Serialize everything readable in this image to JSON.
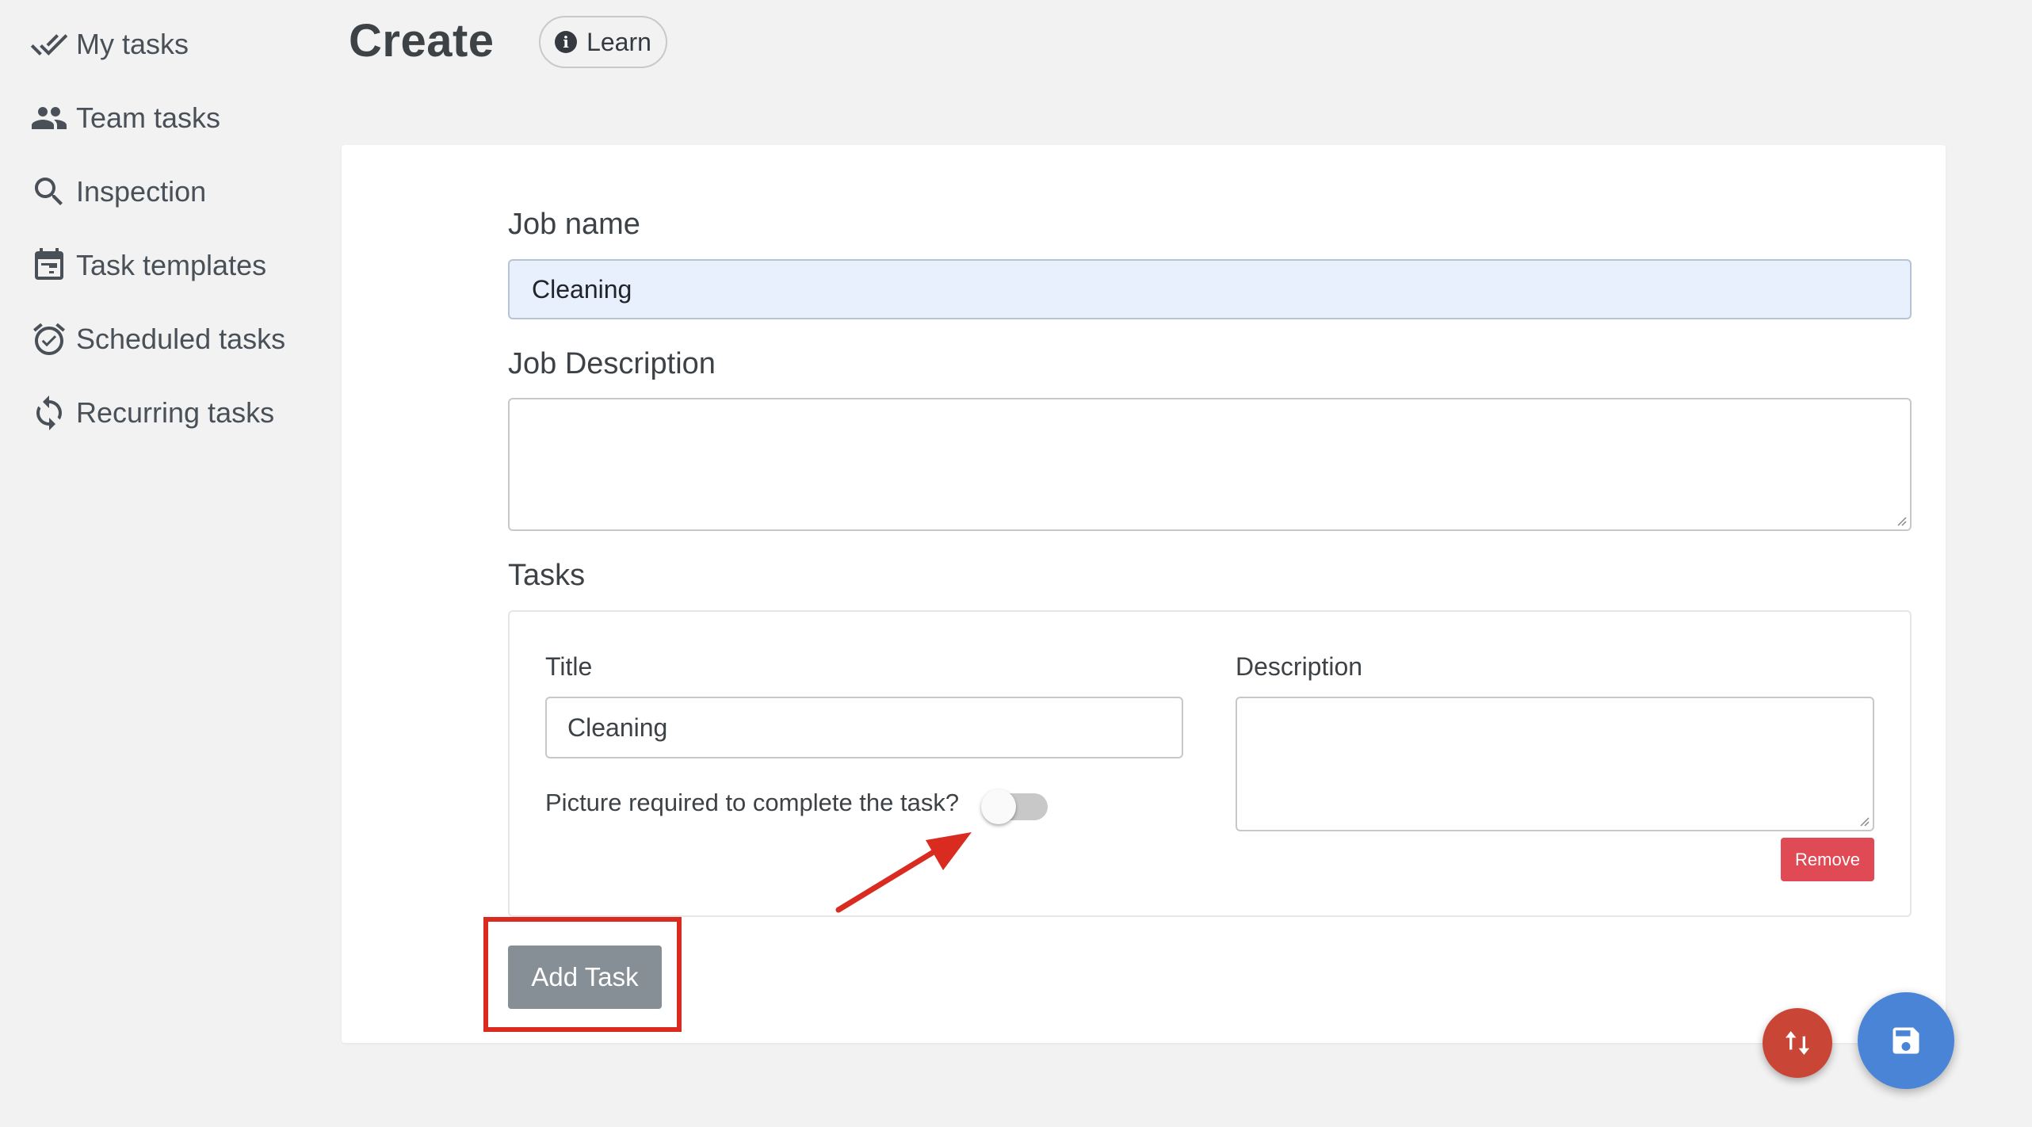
{
  "sidebar": {
    "items": [
      {
        "label": "My tasks",
        "icon": "double-check-icon"
      },
      {
        "label": "Team tasks",
        "icon": "people-icon"
      },
      {
        "label": "Inspection",
        "icon": "search-icon"
      },
      {
        "label": "Task templates",
        "icon": "calendar-icon"
      },
      {
        "label": "Scheduled tasks",
        "icon": "alarm-clock-icon"
      },
      {
        "label": "Recurring tasks",
        "icon": "sync-icon"
      }
    ]
  },
  "header": {
    "title": "Create",
    "learn_label": "Learn"
  },
  "form": {
    "job_name_label": "Job name",
    "job_name_value": "Cleaning",
    "job_description_label": "Job Description",
    "job_description_value": "",
    "tasks_label": "Tasks",
    "task": {
      "title_label": "Title",
      "title_value": "Cleaning",
      "description_label": "Description",
      "description_value": "",
      "picture_required_label": "Picture required to complete the task?",
      "picture_required": false,
      "remove_label": "Remove"
    },
    "add_task_label": "Add Task"
  },
  "colors": {
    "accent_blue": "#4a84d6",
    "fab_red": "#c94535",
    "remove_red": "#e04a55",
    "highlight_red": "#d92b1f",
    "secondary_gray": "#868e96"
  }
}
